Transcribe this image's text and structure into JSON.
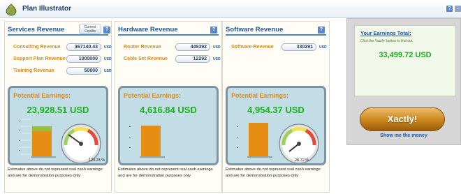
{
  "app": {
    "title": "Plan Illustrator",
    "help_glyph": "?"
  },
  "panels": [
    {
      "title": "Services Revenue",
      "help": "?",
      "current_credits_label": "Current Credits",
      "rows": [
        {
          "label": "Consulting Revenue",
          "value": "367140.43",
          "unit": "USD"
        },
        {
          "label": "Support Plan Revenue",
          "value": "1000000",
          "unit": "USD"
        },
        {
          "label": "Training Revenue",
          "value": "50000",
          "unit": "USD"
        }
      ],
      "earnings_label": "Potential Earnings:",
      "earnings_value": "23,928.51 USD",
      "gauge_percent": "123.23 %",
      "note": "Estimates above do not represent real cash earnings and are for demonstration purposes only"
    },
    {
      "title": "Hardware Revenue",
      "help": "?",
      "rows": [
        {
          "label": "Router Revenue",
          "value": "449392",
          "unit": "USD"
        },
        {
          "label": "Cable Set Revenue",
          "value": "12292",
          "unit": "USD"
        }
      ],
      "earnings_label": "Potential Earnings:",
      "earnings_value": "4,616.84 USD",
      "note": "Estimates above do not represent real cash earnings and are for demonstration purposes only"
    },
    {
      "title": "Software Revenue",
      "help": "?",
      "rows": [
        {
          "label": "Software Revenue",
          "value": "330291",
          "unit": "USD"
        }
      ],
      "earnings_label": "Potential Earnings:",
      "earnings_value": "4,954.37 USD",
      "gauge_percent": "28.72 %",
      "note": "Estimates above do not represent real cash earnings and are for demonstration purposes only"
    }
  ],
  "summary": {
    "title": "Your Earnings Total:",
    "hint": "Click the Xactly! button to find out.",
    "total": "33,499.72  USD",
    "button_label": "Xactly!",
    "link_label": "Show me the money"
  },
  "colors": {
    "accent": "#1f56a8",
    "orange": "#e08a1c",
    "green": "#19b219",
    "panel_bg": "#fffdf6"
  }
}
